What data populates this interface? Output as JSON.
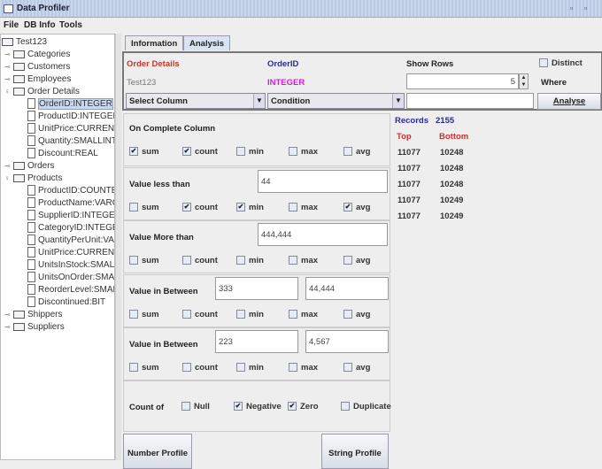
{
  "window": {
    "title": "Data Profiler"
  },
  "menu": [
    "File",
    "DB Info",
    "Tools"
  ],
  "tree": {
    "root": "Test123",
    "nodes": [
      {
        "label": "Categories",
        "type": "table",
        "level": 1,
        "expanded": false
      },
      {
        "label": "Customers",
        "type": "table",
        "level": 1,
        "expanded": false
      },
      {
        "label": "Employees",
        "type": "table",
        "level": 1,
        "expanded": false
      },
      {
        "label": "Order Details",
        "type": "table",
        "level": 1,
        "expanded": true
      },
      {
        "label": "OrderID:INTEGER",
        "type": "column",
        "level": 2,
        "selected": true
      },
      {
        "label": "ProductID:INTEGER",
        "type": "column",
        "level": 2
      },
      {
        "label": "UnitPrice:CURRENCY",
        "type": "column",
        "level": 2
      },
      {
        "label": "Quantity:SMALLINT",
        "type": "column",
        "level": 2
      },
      {
        "label": "Discount:REAL",
        "type": "column",
        "level": 2
      },
      {
        "label": "Orders",
        "type": "table",
        "level": 1,
        "expanded": false
      },
      {
        "label": "Products",
        "type": "table",
        "level": 1,
        "expanded": true
      },
      {
        "label": "ProductID:COUNTER",
        "type": "column",
        "level": 2
      },
      {
        "label": "ProductName:VARCHAR",
        "type": "column",
        "level": 2
      },
      {
        "label": "SupplierID:INTEGER",
        "type": "column",
        "level": 2
      },
      {
        "label": "CategoryID:INTEGER",
        "type": "column",
        "level": 2
      },
      {
        "label": "QuantityPerUnit:VARCHAR",
        "type": "column",
        "level": 2
      },
      {
        "label": "UnitPrice:CURRENCY",
        "type": "column",
        "level": 2
      },
      {
        "label": "UnitsInStock:SMALLINT",
        "type": "column",
        "level": 2
      },
      {
        "label": "UnitsOnOrder:SMALLINT",
        "type": "column",
        "level": 2
      },
      {
        "label": "ReorderLevel:SMALLINT",
        "type": "column",
        "level": 2
      },
      {
        "label": "Discontinued:BIT",
        "type": "column",
        "level": 2
      },
      {
        "label": "Shippers",
        "type": "table",
        "level": 1,
        "expanded": false
      },
      {
        "label": "Suppliers",
        "type": "table",
        "level": 1,
        "expanded": false
      }
    ]
  },
  "tabs": [
    "Information",
    "Analysis"
  ],
  "top": {
    "table": "Order Details",
    "column": "OrderID",
    "database": "Test123",
    "datatype": "INTEGER",
    "show_rows_label": "Show Rows",
    "show_rows_value": "5",
    "distinct_label": "Distinct",
    "where_label": "Where",
    "select_column": "Select Column",
    "condition": "Condition",
    "where_value": "",
    "analyse": "Analyse"
  },
  "colors": {
    "table": "#c0392b",
    "column": "#2a2a9a",
    "datatype": "#d020d0",
    "top": "#d03030"
  },
  "sections": [
    {
      "title": "On Complete Column",
      "inputs": [],
      "checks": [
        true,
        true,
        false,
        false,
        false
      ]
    },
    {
      "title": "Value less than",
      "inputs": [
        "44"
      ],
      "checks": [
        false,
        true,
        true,
        false,
        true
      ]
    },
    {
      "title": "Value More than",
      "inputs": [
        "444,444"
      ],
      "checks": [
        false,
        false,
        false,
        false,
        false
      ]
    },
    {
      "title": "Value in Between",
      "inputs": [
        "333",
        "44,444"
      ],
      "checks": [
        false,
        false,
        false,
        false,
        false
      ]
    },
    {
      "title": "Value in Between",
      "inputs": [
        "223",
        "4,567"
      ],
      "checks": [
        false,
        false,
        false,
        false,
        false
      ]
    }
  ],
  "check_labels": [
    "sum",
    "count",
    "min",
    "max",
    "avg"
  ],
  "count_of": {
    "label": "Count of",
    "options": [
      {
        "label": "Null",
        "checked": false
      },
      {
        "label": "Negative",
        "checked": true
      },
      {
        "label": "Zero",
        "checked": true
      },
      {
        "label": "Duplicate",
        "checked": false
      }
    ]
  },
  "buttons": {
    "number_profile": "Number Profile",
    "string_profile": "String Profile"
  },
  "results": {
    "records_label": "Records",
    "records": "2155",
    "top_label": "Top",
    "bottom_label": "Bottom",
    "rows": [
      [
        "11077",
        "10248"
      ],
      [
        "11077",
        "10248"
      ],
      [
        "11077",
        "10248"
      ],
      [
        "11077",
        "10249"
      ],
      [
        "11077",
        "10249"
      ]
    ]
  }
}
